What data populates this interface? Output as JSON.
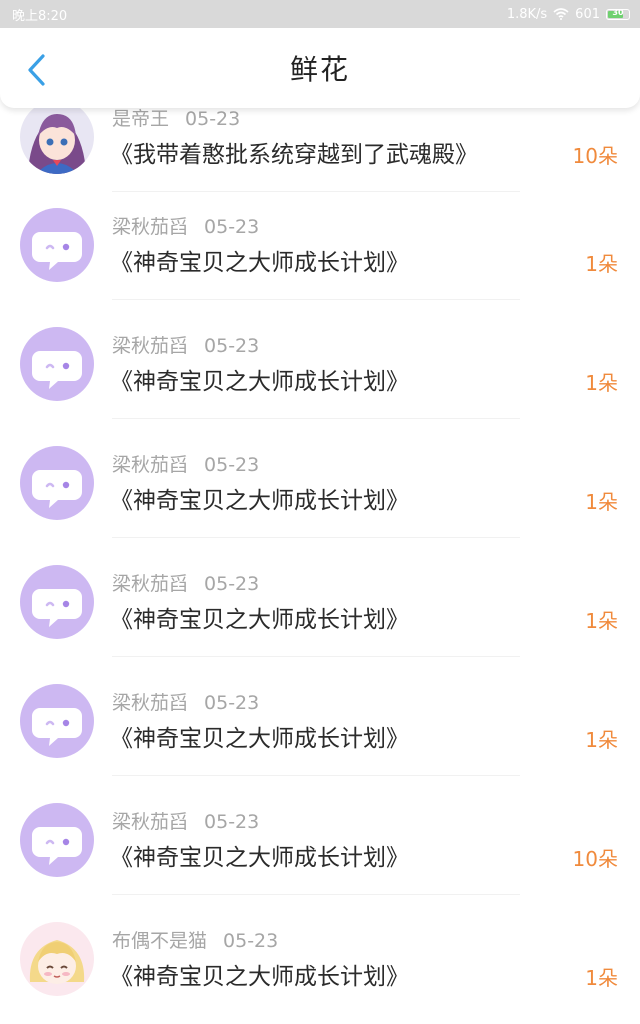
{
  "status_bar": {
    "time": "晚上8:20",
    "net_speed": "1.8K/s",
    "signal": "601",
    "battery": "30"
  },
  "header": {
    "title": "鲜花",
    "back_icon": "chevron-left-icon",
    "accent_color": "#3aa0e6"
  },
  "list": {
    "items": [
      {
        "user": "是帝王",
        "date": "05-23",
        "book": "《我带着憨批系统穿越到了武魂殿》",
        "flowers": "10朵",
        "avatar": "anime-girl-blue"
      },
      {
        "user": "梁秋茄舀",
        "date": "05-23",
        "book": "《神奇宝贝之大师成长计划》",
        "flowers": "1朵",
        "avatar": "chat-bubble-icon"
      },
      {
        "user": "梁秋茄舀",
        "date": "05-23",
        "book": "《神奇宝贝之大师成长计划》",
        "flowers": "1朵",
        "avatar": "chat-bubble-icon"
      },
      {
        "user": "梁秋茄舀",
        "date": "05-23",
        "book": "《神奇宝贝之大师成长计划》",
        "flowers": "1朵",
        "avatar": "chat-bubble-icon"
      },
      {
        "user": "梁秋茄舀",
        "date": "05-23",
        "book": "《神奇宝贝之大师成长计划》",
        "flowers": "1朵",
        "avatar": "chat-bubble-icon"
      },
      {
        "user": "梁秋茄舀",
        "date": "05-23",
        "book": "《神奇宝贝之大师成长计划》",
        "flowers": "1朵",
        "avatar": "chat-bubble-icon"
      },
      {
        "user": "梁秋茄舀",
        "date": "05-23",
        "book": "《神奇宝贝之大师成长计划》",
        "flowers": "10朵",
        "avatar": "chat-bubble-icon"
      },
      {
        "user": "布偶不是猫",
        "date": "05-23",
        "book": "《神奇宝贝之大师成长计划》",
        "flowers": "1朵",
        "avatar": "anime-girl-blonde"
      }
    ]
  },
  "colors": {
    "flower_count": "#f08a3c",
    "chat_avatar_bg": "#cdb8f2",
    "meta_text": "#a6a6a6"
  }
}
